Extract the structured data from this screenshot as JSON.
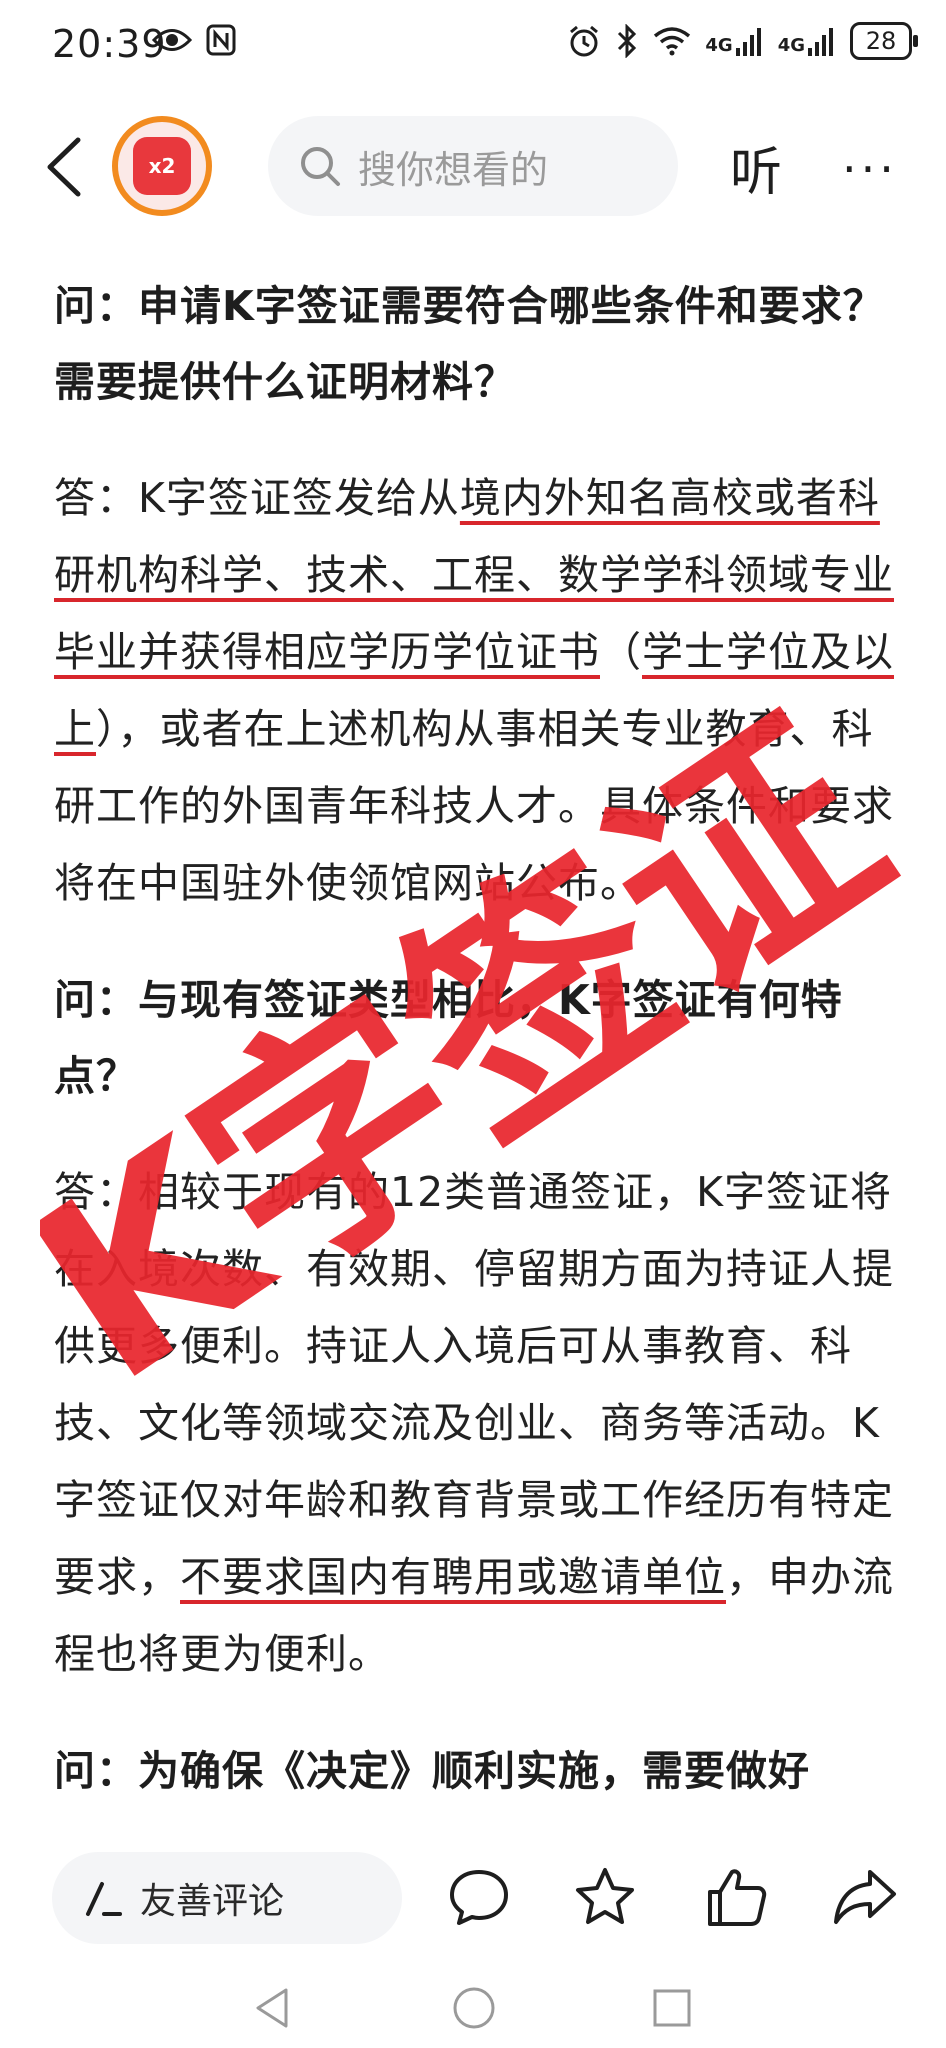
{
  "status_bar": {
    "time": "20:39",
    "left_icons": [
      "eye-icon",
      "nfc-icon"
    ],
    "right_icons": [
      "alarm-icon",
      "bluetooth-icon",
      "wifi-icon",
      "signal-4g-icon",
      "signal-4g-icon"
    ],
    "signal_label_1": "4G",
    "signal_label_2": "4G",
    "battery": "28"
  },
  "header": {
    "avatar_badge": "x2",
    "search_placeholder": "搜你想看的",
    "listen_label": "听",
    "more_label": "···"
  },
  "article": {
    "q1": "问：申请K字签证需要符合哪些条件和要求？需要提供什么证明材料？",
    "a1_prefix": "答：K字签证签发给从",
    "a1_underlined": "境内外知名高校或者科研机构科学、技术、工程、数学学科领域专业毕业并获得相应学历学位证书",
    "a1_mid": "（",
    "a1_underlined2": "学士学位及以上",
    "a1_suffix": "），或者在上述机构从事相关专业教育、科研工作的外国青年科技人才。具体条件和要求将在中国驻外使领馆网站公布。",
    "q2": "问：与现有签证类型相比，K字签证有何特点？",
    "a2_prefix": "答：相较于现有的12类普通签证，K字签证将在入境次数、有效期、停留期方面为持证人提供更多便利。持证人入境后可从事教育、科技、文化等领域交流及创业、商务等活动。K字签证仅对年龄和教育背景或工作经历有特定要求，",
    "a2_underlined": "不要求国内有聘用或邀请单位",
    "a2_suffix": "，申办流程也将更为便利。",
    "q3_partial": "问：为确保《决定》顺利实施，需要做好"
  },
  "stamp": {
    "text": "K字签证",
    "color": "#e8262d"
  },
  "bottom_bar": {
    "comment_placeholder": "友善评论",
    "actions": [
      "comment-icon",
      "favorite-star-icon",
      "like-thumb-icon",
      "share-icon"
    ]
  },
  "nav_bar": {
    "buttons": [
      "nav-back-icon",
      "nav-home-icon",
      "nav-recents-icon"
    ]
  }
}
